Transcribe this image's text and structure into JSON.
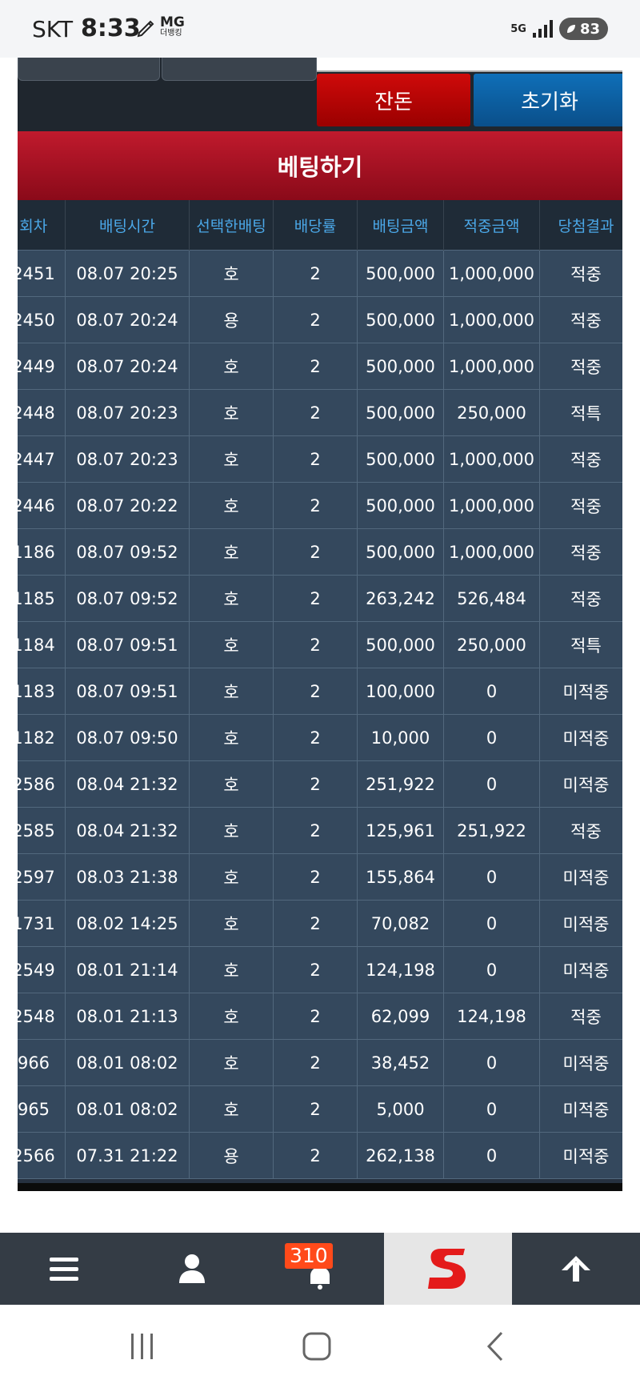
{
  "status_bar": {
    "carrier": "SKT",
    "time": "8:33",
    "app_badge_top": "MG",
    "app_badge_sub": "더뱅킹",
    "network": "5G",
    "battery": "83"
  },
  "actions": {
    "red_label": "잔돈",
    "blue_label": "초기화"
  },
  "section_title": "베팅하기",
  "table": {
    "headers": [
      "회차",
      "배팅시간",
      "선택한배팅",
      "배당률",
      "배팅금액",
      "적중금액",
      "당첨결과"
    ],
    "rows": [
      [
        "2451",
        "08.07 20:25",
        "호",
        "2",
        "500,000",
        "1,000,000",
        "적중"
      ],
      [
        "2450",
        "08.07 20:24",
        "용",
        "2",
        "500,000",
        "1,000,000",
        "적중"
      ],
      [
        "2449",
        "08.07 20:24",
        "호",
        "2",
        "500,000",
        "1,000,000",
        "적중"
      ],
      [
        "2448",
        "08.07 20:23",
        "호",
        "2",
        "500,000",
        "250,000",
        "적특"
      ],
      [
        "2447",
        "08.07 20:23",
        "호",
        "2",
        "500,000",
        "1,000,000",
        "적중"
      ],
      [
        "2446",
        "08.07 20:22",
        "호",
        "2",
        "500,000",
        "1,000,000",
        "적중"
      ],
      [
        "1186",
        "08.07 09:52",
        "호",
        "2",
        "500,000",
        "1,000,000",
        "적중"
      ],
      [
        "1185",
        "08.07 09:52",
        "호",
        "2",
        "263,242",
        "526,484",
        "적중"
      ],
      [
        "1184",
        "08.07 09:51",
        "호",
        "2",
        "500,000",
        "250,000",
        "적특"
      ],
      [
        "1183",
        "08.07 09:51",
        "호",
        "2",
        "100,000",
        "0",
        "미적중"
      ],
      [
        "1182",
        "08.07 09:50",
        "호",
        "2",
        "10,000",
        "0",
        "미적중"
      ],
      [
        "2586",
        "08.04 21:32",
        "호",
        "2",
        "251,922",
        "0",
        "미적중"
      ],
      [
        "2585",
        "08.04 21:32",
        "호",
        "2",
        "125,961",
        "251,922",
        "적중"
      ],
      [
        "2597",
        "08.03 21:38",
        "호",
        "2",
        "155,864",
        "0",
        "미적중"
      ],
      [
        "1731",
        "08.02 14:25",
        "호",
        "2",
        "70,082",
        "0",
        "미적중"
      ],
      [
        "2549",
        "08.01 21:14",
        "호",
        "2",
        "124,198",
        "0",
        "미적중"
      ],
      [
        "2548",
        "08.01 21:13",
        "호",
        "2",
        "62,099",
        "124,198",
        "적중"
      ],
      [
        "966",
        "08.01 08:02",
        "호",
        "2",
        "38,452",
        "0",
        "미적중"
      ],
      [
        "965",
        "08.01 08:02",
        "호",
        "2",
        "5,000",
        "0",
        "미적중"
      ],
      [
        "2566",
        "07.31 21:22",
        "용",
        "2",
        "262,138",
        "0",
        "미적중"
      ]
    ]
  },
  "bottom_nav": {
    "notification_count": "310",
    "items": [
      "menu-icon",
      "user-icon",
      "bell-icon",
      "s-logo-icon",
      "arrow-up-icon"
    ]
  },
  "colors": {
    "win": "#0e8a1c",
    "special": "#f0a63a",
    "lose": "#ff2a2a",
    "header_text": "#4ba8e8",
    "red_button": "#c00000",
    "blue_button": "#0a5fa0"
  }
}
